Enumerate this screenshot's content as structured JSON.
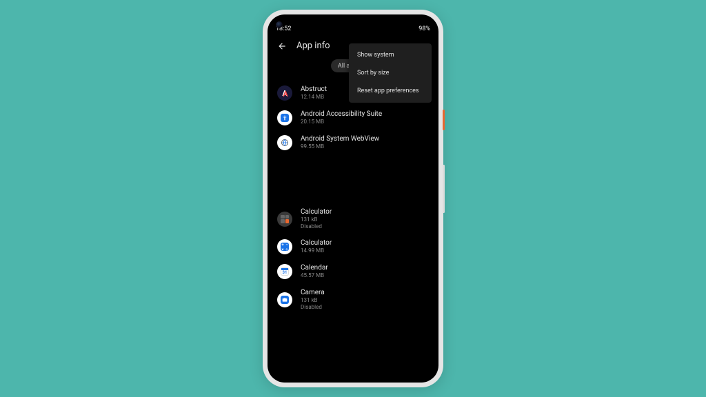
{
  "status": {
    "time": "18:52",
    "battery": "98%"
  },
  "header": {
    "title": "App info"
  },
  "filter": {
    "chip": "All apps"
  },
  "menu": {
    "item1": "Show system",
    "item2": "Sort by size",
    "item3": "Reset app preferences"
  },
  "apps": [
    {
      "name": "Abstruct",
      "size": "12.14 MB",
      "status": ""
    },
    {
      "name": "Android Accessibility Suite",
      "size": "20.15 MB",
      "status": ""
    },
    {
      "name": "Android System WebView",
      "size": "99.55 MB",
      "status": ""
    },
    {
      "name": "Calculator",
      "size": "131 kB",
      "status": "Disabled"
    },
    {
      "name": "Calculator",
      "size": "14.99 MB",
      "status": ""
    },
    {
      "name": "Calendar",
      "size": "45.57 MB",
      "status": ""
    },
    {
      "name": "Camera",
      "size": "131 kB",
      "status": "Disabled"
    }
  ]
}
